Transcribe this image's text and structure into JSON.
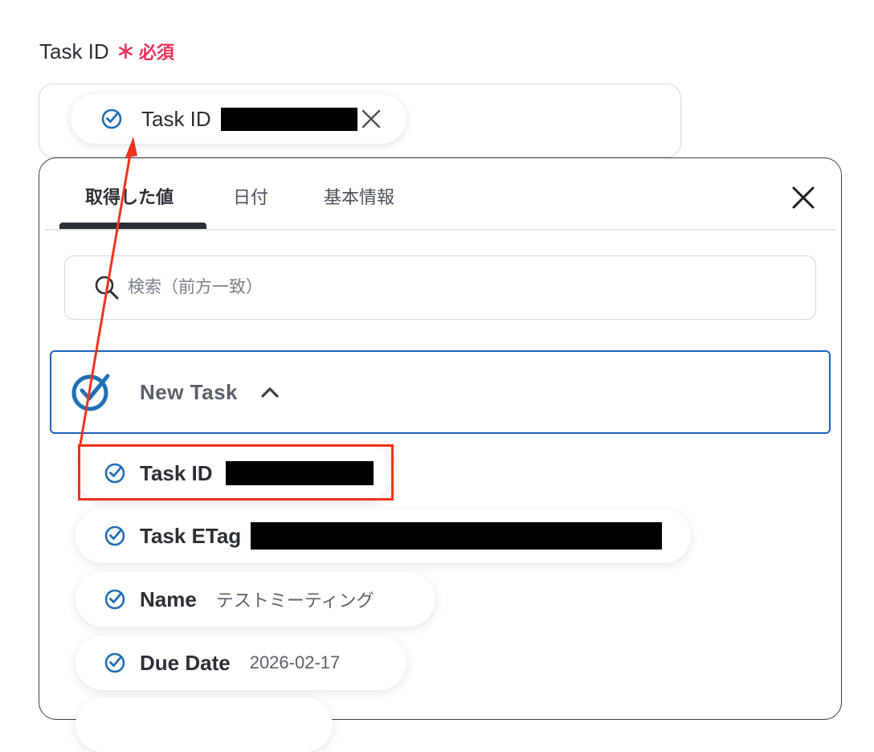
{
  "field": {
    "label": "Task ID",
    "required_star": "∗",
    "required_text": "必須",
    "chip_text": "Task ID"
  },
  "panel": {
    "tabs": [
      {
        "label": "取得した値",
        "active": true
      },
      {
        "label": "日付",
        "active": false
      },
      {
        "label": "基本情報",
        "active": false
      }
    ],
    "search_placeholder": "検索（前方一致）",
    "group": {
      "title": "New Task",
      "expanded": true
    },
    "items": [
      {
        "label": "Task ID",
        "value": "",
        "redacted": true
      },
      {
        "label": "Task ETag",
        "value": "",
        "redacted": true
      },
      {
        "label": "Name",
        "value": "テストミーティング",
        "redacted": false
      },
      {
        "label": "Due Date",
        "value": "2026-02-17",
        "redacted": false
      }
    ]
  },
  "icons": {
    "item_icon": "check-circle-icon",
    "group_icon": "check-circle-icon",
    "remove_icon": "close-icon",
    "panel_close_icon": "close-icon",
    "search_icon": "search-icon",
    "chevron_icon": "chevron-up-icon"
  },
  "colors": {
    "accent_blue": "#1a63c2",
    "icon_blue": "#1f6fb5",
    "required_red": "#e5325a",
    "annotation_red": "#f0321e"
  }
}
